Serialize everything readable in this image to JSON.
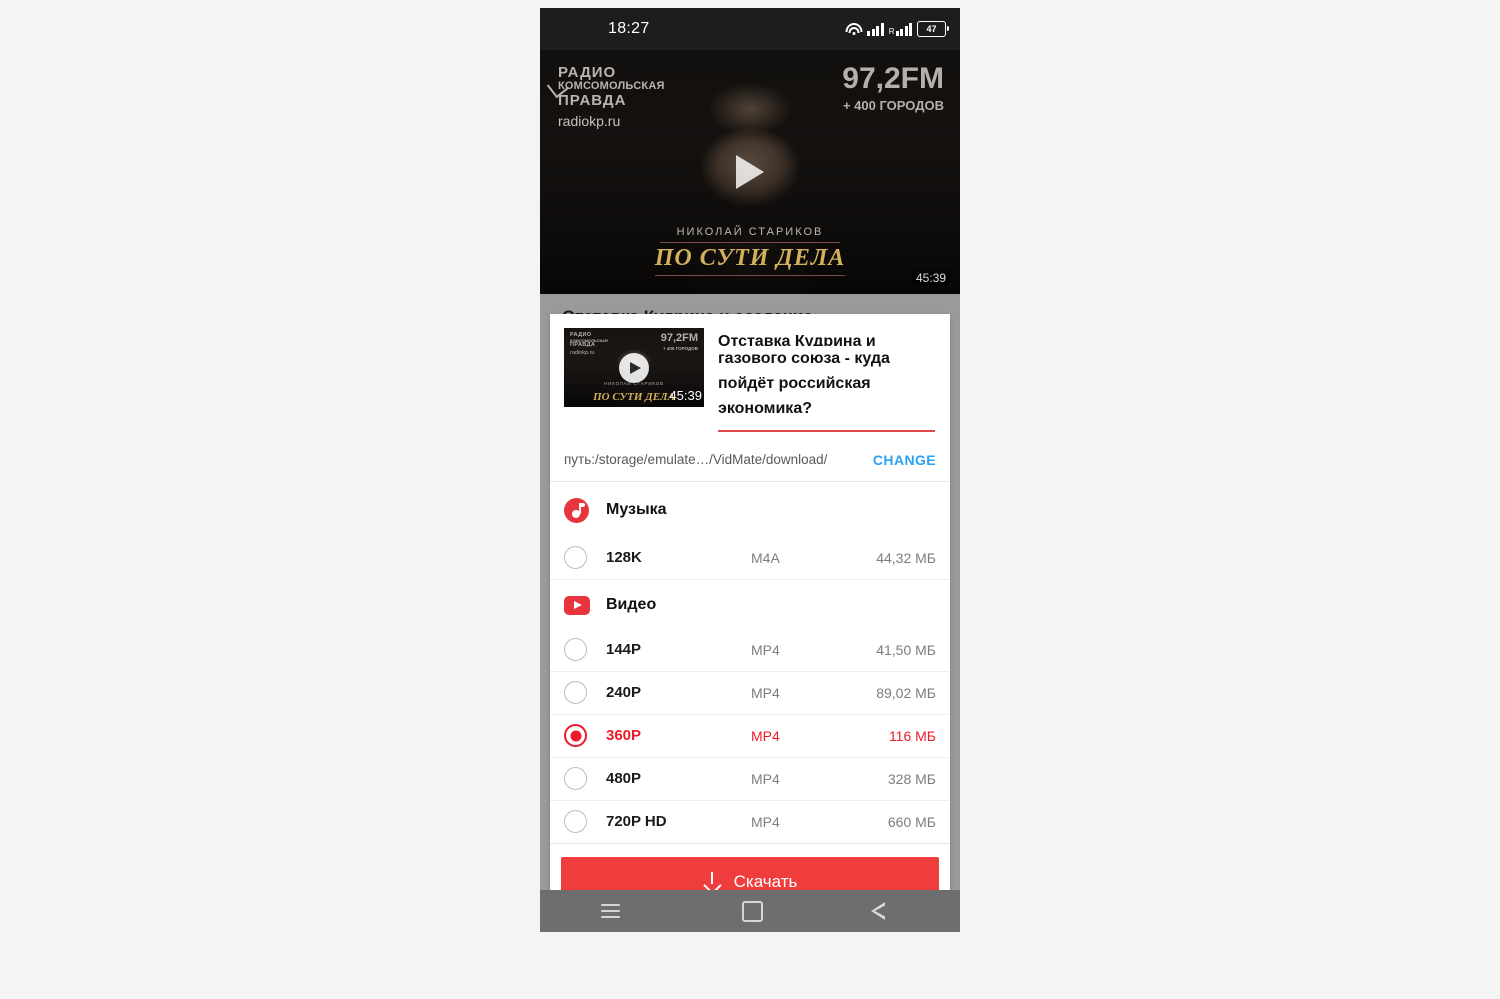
{
  "status_bar": {
    "time": "18:27",
    "battery_level": "47",
    "wifi_icon": "wifi-icon",
    "signal_icon": "signal-bars-icon",
    "roaming_label": "R"
  },
  "background_page": {
    "article_title": "Отставка Кудрина и создание",
    "video": {
      "logo_line1": "РАДИО",
      "logo_line2": "КОМСОМОЛЬСКАЯ",
      "logo_line3": "ПРАВДА",
      "site": "radiokp.ru",
      "frequency": "97,2FM",
      "cities": "+ 400 ГОРОДОВ",
      "host": "НИКОЛАЙ СТАРИКОВ",
      "show_title": "ПО СУТИ ДЕЛА",
      "duration": "45:39",
      "play_icon": "play-icon"
    }
  },
  "dialog": {
    "thumbnail": {
      "logo_line1": "РАДИО",
      "logo_line2": "КОМСОМОЛЬСКАЯ",
      "logo_line3": "ПРАВДА",
      "site": "radiokp.ru",
      "frequency": "97,2FM",
      "cities": "+ 400 ГОРОДОВ",
      "host": "НИКОЛАЙ СТАРИКОВ",
      "show_title": "ПО СУТИ ДЕЛА",
      "duration": "45:39",
      "play_icon": "play-icon"
    },
    "title_field": {
      "value": "газового союза - куда пойдёт российская экономика?",
      "clipped_line": "Отставка Кудрина и создание"
    },
    "path": {
      "label": "путь:/storage/emulate…/VidMate/download/",
      "change_button": "CHANGE"
    },
    "music_section": {
      "icon": "music-note-icon",
      "label": "Музыка",
      "items": [
        {
          "quality": "128K",
          "format": "M4A",
          "size": "44,32 МБ",
          "selected": false
        }
      ]
    },
    "video_section": {
      "icon": "video-play-icon",
      "label": "Видео",
      "items": [
        {
          "quality": "144P",
          "format": "MP4",
          "size": "41,50 МБ",
          "selected": false
        },
        {
          "quality": "240P",
          "format": "MP4",
          "size": "89,02 МБ",
          "selected": false
        },
        {
          "quality": "360P",
          "format": "MP4",
          "size": "116 МБ",
          "selected": true
        },
        {
          "quality": "480P",
          "format": "MP4",
          "size": "328 МБ",
          "selected": false
        },
        {
          "quality": "720P HD",
          "format": "MP4",
          "size": "660 МБ",
          "selected": false
        }
      ]
    },
    "download_button": {
      "label": "Скачать",
      "icon": "download-icon"
    }
  },
  "nav_bar": {
    "menu_icon": "menu-icon",
    "home_icon": "home-icon",
    "back_icon": "back-icon"
  },
  "colors": {
    "accent_red": "#ef1a27",
    "button_red": "#ef3c3c",
    "link_blue": "#2ca2f0",
    "gold": "#d2b15a"
  }
}
